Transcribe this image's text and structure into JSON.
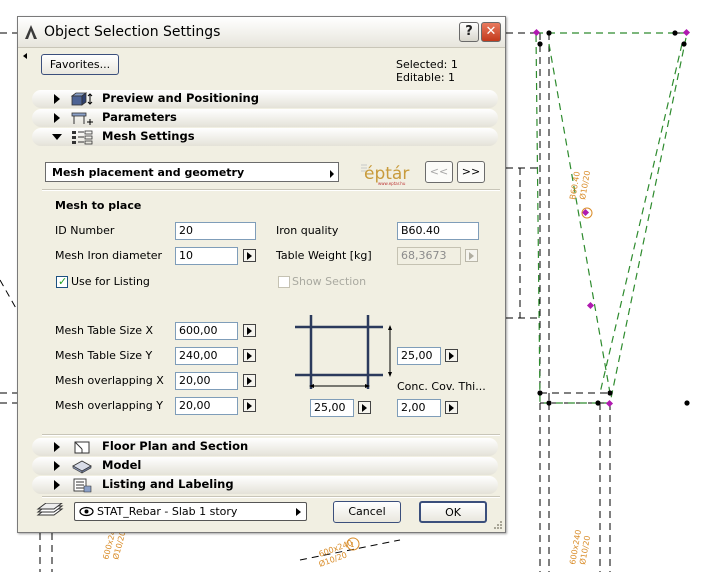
{
  "window": {
    "title": "Object Selection Settings",
    "help_label": "?",
    "close_label": "✕"
  },
  "toolbar": {
    "favorites_label": "Favorites...",
    "selection_info": "Selected: 1 Editable: 1"
  },
  "sections": {
    "preview": "Preview and Positioning",
    "parameters": "Parameters",
    "mesh": "Mesh Settings",
    "floorplan": "Floor Plan and Section",
    "model": "Model",
    "listing": "Listing and Labeling"
  },
  "mesh": {
    "page_select": "Mesh placement and geometry",
    "logo_text": "éptár",
    "logo_sub": "www.eptar.hu",
    "prev_label": "<<",
    "next_label": ">>",
    "group_title": "Mesh to place",
    "id_label": "ID Number",
    "id_value": "20",
    "iron_quality_label": "Iron quality",
    "iron_quality_value": "B60.40",
    "diameter_label": "Mesh Iron diameter",
    "diameter_value": "10",
    "table_weight_label": "Table Weight [kg]",
    "table_weight_value": "68,3673",
    "use_listing_label": "Use for Listing",
    "show_section_label": "Show Section",
    "size_x_label": "Mesh Table Size X",
    "size_x_value": "600,00",
    "size_y_label": "Mesh Table Size Y",
    "size_y_value": "240,00",
    "overlap_x_label": "Mesh overlapping X",
    "overlap_x_value": "20,00",
    "overlap_y_label": "Mesh overlapping Y",
    "overlap_y_value": "20,00",
    "spacing_v_value": "25,00",
    "spacing_h_value": "25,00",
    "cover_label": "Conc. Cov. Thi...",
    "cover_value": "2,00"
  },
  "footer": {
    "layer_value": "STAT_Rebar - Slab 1 story",
    "cancel_label": "Cancel",
    "ok_label": "OK"
  },
  "drawing": {
    "label_a": "B60.40",
    "label_b": "600x240",
    "label_c": "Ø10/20",
    "marker": "1"
  },
  "colors": {
    "dashed_green": "#2e8b2e",
    "dashed_black": "#000000",
    "annotation_orange": "#d98c28",
    "vertex_magenta": "#b01ab0"
  }
}
